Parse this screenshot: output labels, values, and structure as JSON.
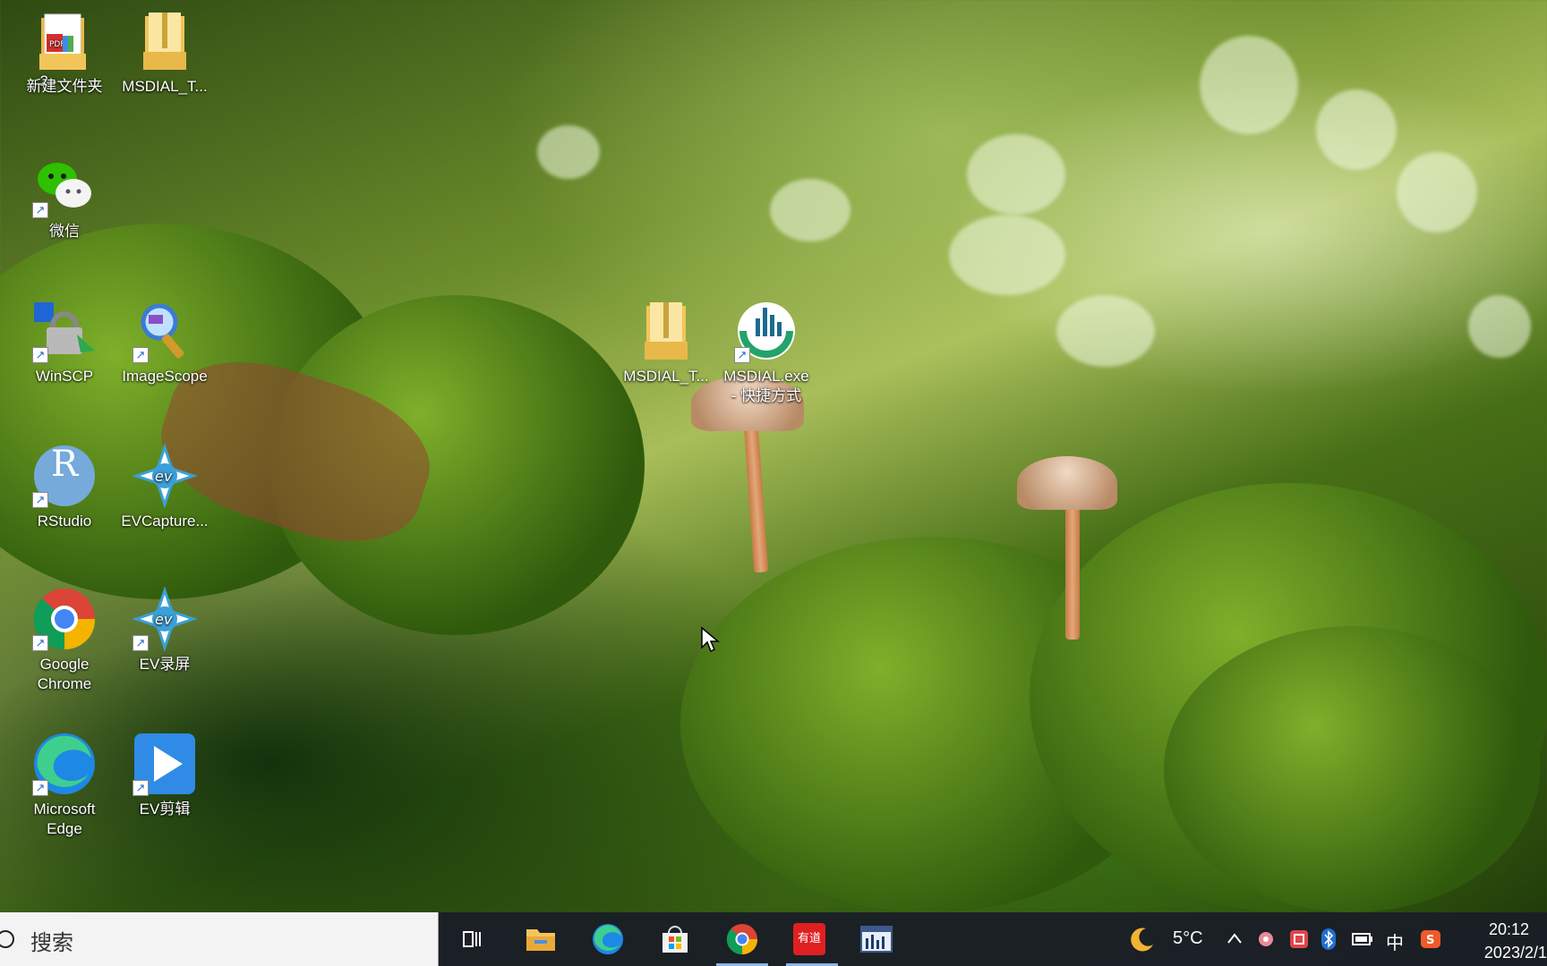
{
  "desktop_icons": {
    "partial_left_1": "2",
    "new_folder": "新建文件夹",
    "msdial_t_1": "MSDIAL_T...",
    "wechat": "微信",
    "partial_left_2": "e",
    "winscp": "WinSCP",
    "imagescope": "ImageScope",
    "rstudio": "RStudio",
    "rstudio_letter": "R",
    "evcapture": "EVCapture...",
    "chrome_line1": "Google",
    "chrome_line2": "Chrome",
    "ev_record": "EV录屏",
    "edge_line1": "Microsoft",
    "edge_line2": "Edge",
    "ev_edit": "EV剪辑",
    "msdial_t_2": "MSDIAL_T...",
    "msdial_exe_line1": "MSDIAL.exe",
    "msdial_exe_line2": "- 快捷方式"
  },
  "taskbar": {
    "search_placeholder": "搜索",
    "apps": [
      "task-view",
      "file-explorer",
      "edge",
      "microsoft-store",
      "chrome",
      "youdao",
      "msdial"
    ],
    "youdao_label": "有道"
  },
  "tray": {
    "weather_icon": "moon-icon",
    "temperature": "5°C",
    "ime": "中",
    "time": "20:12",
    "date": "2023/2/1"
  },
  "colors": {
    "taskbar_bg": "#1a1e26",
    "search_bg": "#f3f3f3",
    "active_indicator": "#8fb4e6"
  }
}
